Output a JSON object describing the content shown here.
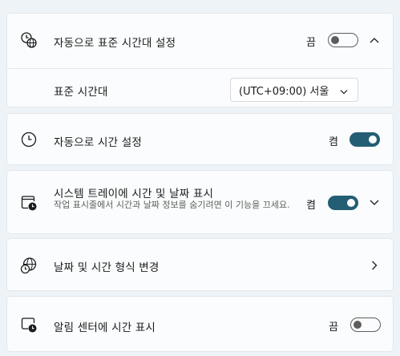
{
  "auto_timezone": {
    "label": "자동으로 표준 시간대 설정",
    "state": "끔",
    "on": false
  },
  "timezone": {
    "label": "표준 시간대",
    "value": "(UTC+09:00) 서울"
  },
  "auto_time": {
    "label": "자동으로 시간 설정",
    "state": "켬",
    "on": true
  },
  "tray": {
    "label": "시스템 트레이에 시간 및 날짜 표시",
    "desc": "작업 표시줄에서 시간과 날짜 정보를 숨기려면 이 기능을 끄세요.",
    "state": "켬",
    "on": true
  },
  "format": {
    "label": "날짜 및 시간 형식 변경"
  },
  "notif": {
    "label": "알림 센터에 시간 표시",
    "state": "끔",
    "on": false
  },
  "colors": {
    "toggle_on": "#245e74",
    "background": "#eef3f8",
    "card": "#fbfcfd"
  }
}
